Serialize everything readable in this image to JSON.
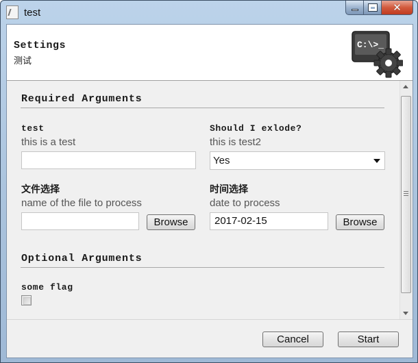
{
  "window": {
    "title": "test",
    "close_glyph": "✕"
  },
  "header": {
    "title": "Settings",
    "subtitle": "测试",
    "logo_text": "C:\\>_",
    "logo_icon": "terminal-gear-icon"
  },
  "required": {
    "section_title": "Required Arguments",
    "test": {
      "name": "test",
      "help": "this is a test",
      "value": ""
    },
    "exlode": {
      "name": "Should I exlode?",
      "help": "this is test2",
      "selected": "Yes"
    },
    "file": {
      "name": "文件选择",
      "help": "name of the file to process",
      "value": "",
      "browse_label": "Browse"
    },
    "date": {
      "name": "时间选择",
      "help": "date to process",
      "value": "2017-02-15",
      "browse_label": "Browse"
    }
  },
  "optional": {
    "section_title": "Optional Arguments",
    "flag": {
      "name": "some flag",
      "checked": false
    }
  },
  "footer": {
    "cancel_label": "Cancel",
    "start_label": "Start"
  }
}
